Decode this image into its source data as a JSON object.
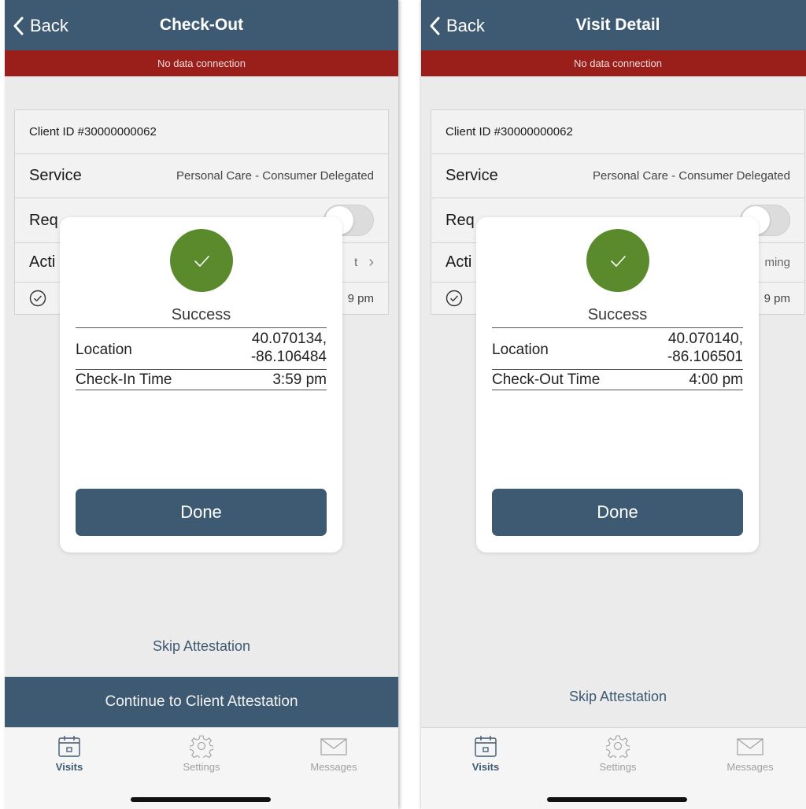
{
  "screens": [
    {
      "nav": {
        "back_label": "Back",
        "title": "Check-Out"
      },
      "banner": "No data connection",
      "form": {
        "client_id": "Client ID #30000000062",
        "service_label": "Service",
        "service_value": "Personal Care - Consumer Delegated",
        "qr_label_visible": "Req",
        "activity_label_visible": "Acti",
        "activity_value_visible": "t",
        "attestation_time_visible": "9 pm"
      },
      "modal": {
        "status": "Success",
        "location_label": "Location",
        "location_line1": "40.070134,",
        "location_line2": "-86.106484",
        "time_label": "Check-In Time",
        "time_value": "3:59 pm",
        "done_label": "Done"
      },
      "skip_label": "Skip Attestation",
      "continue_label": "Continue to Client Attestation",
      "tabs": {
        "visits": "Visits",
        "settings": "Settings",
        "messages": "Messages"
      }
    },
    {
      "nav": {
        "back_label": "Back",
        "title": "Visit Detail"
      },
      "banner": "No data connection",
      "form": {
        "client_id": "Client ID #30000000062",
        "service_label": "Service",
        "service_value": "Personal Care - Consumer Delegated",
        "qr_label_visible": "Req",
        "activity_label_visible": "Acti",
        "activity_value_visible": "ming",
        "attestation_time_visible": "9 pm"
      },
      "modal": {
        "status": "Success",
        "location_label": "Location",
        "location_line1": "40.070140,",
        "location_line2": "-86.106501",
        "time_label": "Check-Out Time",
        "time_value": "4:00 pm",
        "done_label": "Done"
      },
      "skip_label": "Skip Attestation",
      "tabs": {
        "visits": "Visits",
        "settings": "Settings",
        "messages": "Messages"
      }
    }
  ],
  "icons": {
    "back": "chevron-left-icon",
    "success": "checkmark-icon",
    "activity_chevron": "chevron-right-icon",
    "attestation": "check-circle-icon",
    "visits": "calendar-icon",
    "settings": "gear-icon",
    "messages": "envelope-icon"
  },
  "colors": {
    "primary": "#3e5a72",
    "offline_banner": "#9a1f1b",
    "success": "#5b8a2c"
  }
}
